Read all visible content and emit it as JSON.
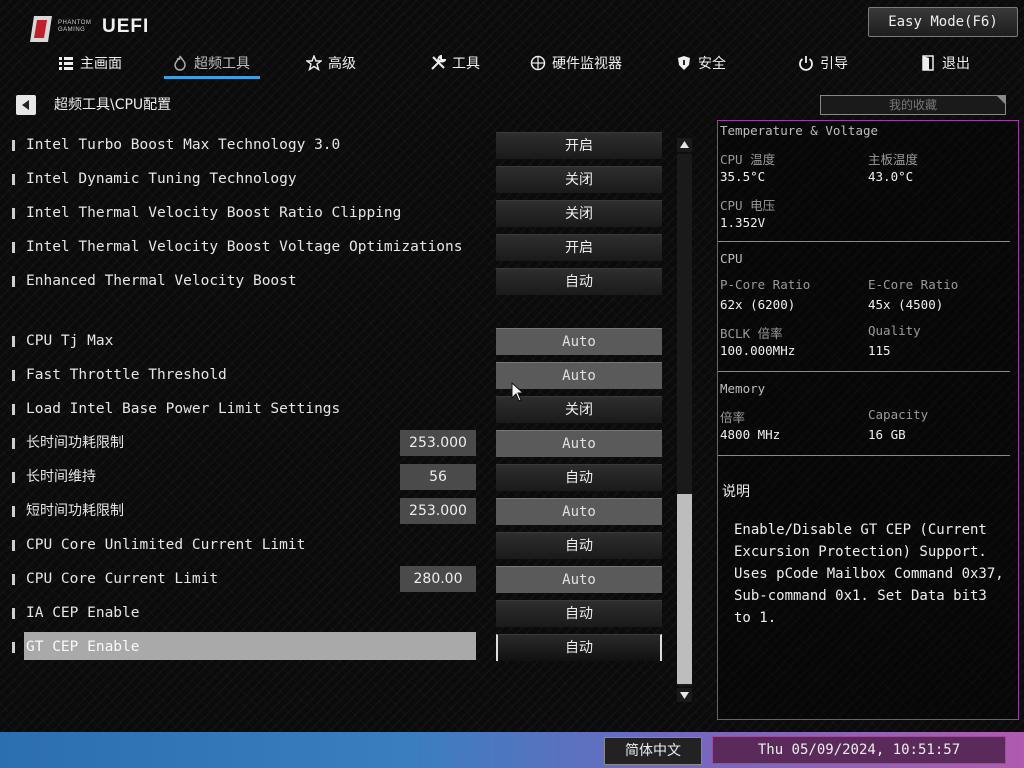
{
  "header": {
    "brand_small": "PHANTOM GAMING",
    "brand_uefi": "UEFI",
    "easy_mode_label": "Easy Mode(F6)"
  },
  "nav": {
    "tabs": [
      {
        "label": "主画面",
        "icon": "list-icon"
      },
      {
        "label": "超频工具",
        "icon": "flame-icon",
        "active": true
      },
      {
        "label": "高级",
        "icon": "star-icon"
      },
      {
        "label": "工具",
        "icon": "tools-icon"
      },
      {
        "label": "硬件监视器",
        "icon": "monitor-icon"
      },
      {
        "label": "安全",
        "icon": "shield-icon"
      },
      {
        "label": "引导",
        "icon": "power-icon"
      },
      {
        "label": "退出",
        "icon": "exit-icon"
      }
    ]
  },
  "breadcrumb": "超频工具\\CPU配置",
  "favorites_label": "我的收藏",
  "settings": [
    {
      "label": "Intel Turbo Boost Max Technology 3.0",
      "value": "开启"
    },
    {
      "label": "Intel Dynamic Tuning Technology",
      "value": "关闭"
    },
    {
      "label": "Intel Thermal Velocity Boost Ratio Clipping",
      "value": "关闭"
    },
    {
      "label": "Intel Thermal Velocity Boost Voltage Optimizations",
      "value": "开启"
    },
    {
      "label": "Enhanced Thermal Velocity Boost",
      "value": "自动"
    },
    {
      "label": "CPU Tj Max",
      "value": "Auto"
    },
    {
      "label": "Fast Throttle Threshold",
      "value": "Auto"
    },
    {
      "label": "Load Intel Base Power Limit Settings",
      "value": "关闭"
    },
    {
      "label": "长时间功耗限制",
      "number": "253.000",
      "value": "Auto"
    },
    {
      "label": "长时间维持",
      "number": "56",
      "value": "自动"
    },
    {
      "label": "短时间功耗限制",
      "number": "253.000",
      "value": "Auto"
    },
    {
      "label": "CPU Core Unlimited Current Limit",
      "value": "自动"
    },
    {
      "label": "CPU Core Current Limit",
      "number": "280.00",
      "value": "Auto"
    },
    {
      "label": "IA CEP Enable",
      "value": "自动"
    },
    {
      "label": "GT CEP Enable",
      "value": "自动"
    }
  ],
  "panel": {
    "temp_title": "Temperature & Voltage",
    "cpu_temp_label": "CPU 温度",
    "cpu_temp_value": "35.5°C",
    "mb_temp_label": "主板温度",
    "mb_temp_value": "43.0°C",
    "cpu_volt_label": "CPU 电压",
    "cpu_volt_value": "1.352V",
    "cpu_title": "CPU",
    "pcore_label": "P-Core Ratio",
    "pcore_value": "62x (6200)",
    "ecore_label": "E-Core Ratio",
    "ecore_value": "45x (4500)",
    "bclk_label": "BCLK 倍率",
    "bclk_value": "100.000MHz",
    "quality_label": "Quality",
    "quality_value": "115",
    "memory_title": "Memory",
    "freq_label": "倍率",
    "freq_value": "4800 MHz",
    "capacity_label": "Capacity",
    "capacity_value": "16 GB",
    "desc_title": "说明",
    "desc_text": "Enable/Disable GT CEP (Current Excursion Protection) Support. Uses pCode Mailbox Command 0x37, Sub-command 0x1. Set Data bit3 to 1."
  },
  "footer": {
    "language": "简体中文",
    "datetime": "Thu 05/09/2024, 10:51:57"
  },
  "colors": {
    "accent_blue": "#3aa0e0",
    "panel_border": "#9c3ea0",
    "auto_button": "#5a5a5a",
    "selected_row": "#a9a9a9"
  }
}
